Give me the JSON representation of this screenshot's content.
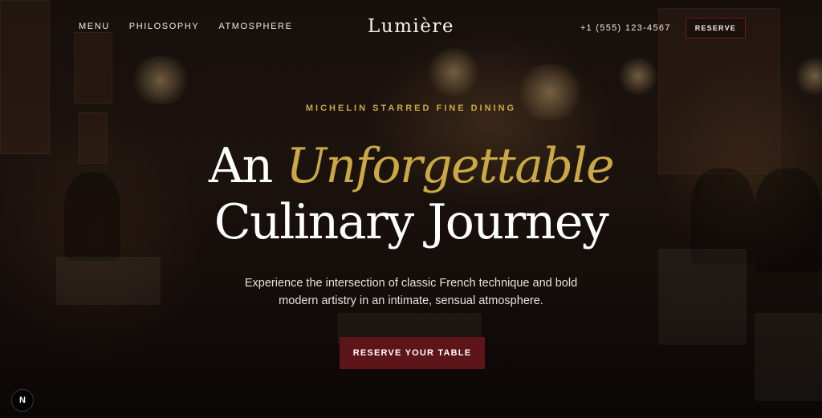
{
  "nav": {
    "links": [
      "MENU",
      "PHILOSOPHY",
      "ATMOSPHERE"
    ],
    "brand": "Lumière",
    "phone": "+1 (555) 123-4567",
    "reserve_label": "RESERVE"
  },
  "hero": {
    "eyebrow": "MICHELIN STARRED FINE DINING",
    "headline_line1_prefix": "An",
    "headline_accent": "Unforgettable",
    "headline_line2": "Culinary Journey",
    "subtitle_line1": "Experience the intersection of classic French technique and bold",
    "subtitle_line2": "modern artistry in an intimate, sensual atmosphere.",
    "cta_label": "RESERVE YOUR TABLE"
  },
  "dev_badge": "N",
  "colors": {
    "accent_gold": "#c9a845",
    "button_burgundy": "#5e1519",
    "text_light": "#f1ece6"
  }
}
